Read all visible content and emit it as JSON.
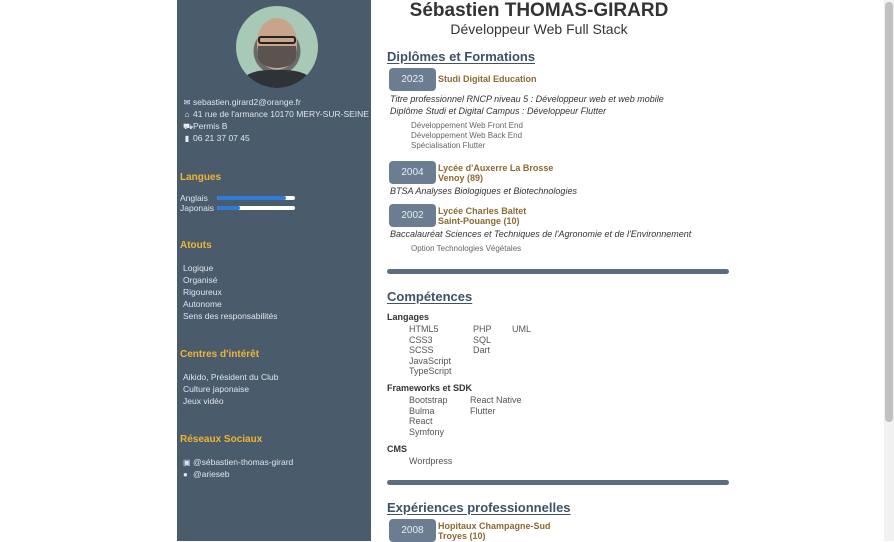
{
  "header": {
    "name": "Sébastien THOMAS-GIRARD",
    "role": "Développeur Web Full Stack"
  },
  "sidebar": {
    "contact": [
      {
        "icon": "envelope-icon",
        "text": "sebastien.girard2@orange.fr"
      },
      {
        "icon": "home-icon",
        "text": "41 rue de l'armance 10170 MERY-SUR-SEINE"
      },
      {
        "icon": "car-icon",
        "text": "Permis B"
      },
      {
        "icon": "phone-icon",
        "text": "06 21 37 07 45"
      }
    ],
    "languages_title": "Langues",
    "languages": [
      {
        "label": "Anglais",
        "level": 0.88
      },
      {
        "label": "Japonais",
        "level": 0.3
      }
    ],
    "assets_title": "Atouts",
    "assets": [
      "Logique",
      "Organisé",
      "Rigoureux",
      "Autonome",
      "Sens des responsabilités"
    ],
    "interests_title": "Centres d'intérêt",
    "interests": [
      "Aikido, Président du Club",
      "Culture japonaise",
      "Jeux vidéo"
    ],
    "social_title": "Réseaux Sociaux",
    "social": [
      {
        "icon": "linkedin-icon",
        "text": "@sébastien-thomas-girard"
      },
      {
        "icon": "github-icon",
        "text": "@arieseb"
      }
    ]
  },
  "education": {
    "title": "Diplômes et Formations",
    "items": [
      {
        "year": "2023",
        "institution": [
          "Studi Digital Education"
        ],
        "degrees": [
          "Titre professionnel RNCP niveau 5 : Développeur web et web mobile",
          "Diplôme Studi et Digital Campus : Développeur Flutter"
        ],
        "details": [
          "Développement Web Front End",
          "Développement Web Back End",
          "Spécialisation Flutter"
        ]
      },
      {
        "year": "2004",
        "institution": [
          "Lycée d'Auxerre La Brosse",
          "Venoy (89)"
        ],
        "degrees": [
          "BTSA Analyses Biologiques et Biotechnologies"
        ],
        "details": []
      },
      {
        "year": "2002",
        "institution": [
          "Lycée Charles Baltet",
          "Saint-Pouange (10)"
        ],
        "degrees": [
          "Baccalauréat Sciences et Techniques de l'Agronomie et de l'Environnement"
        ],
        "details": [
          "Option Technologies Végétales"
        ]
      }
    ]
  },
  "skills": {
    "title": "Compétences",
    "languages_title": "Langages",
    "languages_cols": [
      [
        "HTML5",
        "CSS3",
        "SCSS",
        "JavaScript",
        "TypeScript"
      ],
      [
        "PHP",
        "SQL",
        "Dart"
      ],
      [
        "UML"
      ]
    ],
    "frameworks_title": "Frameworks et SDK",
    "frameworks_cols": [
      [
        "Bootstrap",
        "Bulma",
        "React",
        "Symfony"
      ],
      [
        "React Native",
        "Flutter"
      ]
    ],
    "cms_title": "CMS",
    "cms_cols": [
      [
        "Wordpress"
      ]
    ]
  },
  "experience": {
    "title": "Expériences professionnelles",
    "items": [
      {
        "year": "2008",
        "institution": [
          "Hopitaux Champagne-Sud",
          "Troyes (10)"
        ]
      }
    ]
  },
  "colors": {
    "sidebar_bg": "#4a5b6c",
    "accent": "#f0b533",
    "year_badge": "#6a7d91",
    "institution": "#8a6a34",
    "language_bar": "#2f7bd8"
  }
}
